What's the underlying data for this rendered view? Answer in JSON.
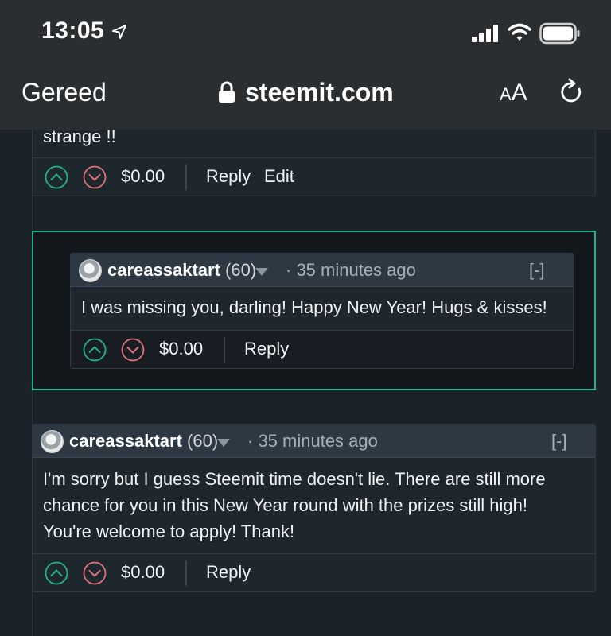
{
  "status_bar": {
    "time": "13:05"
  },
  "browser": {
    "back_label": "Gereed",
    "url": "steemit.com",
    "text_size_small": "A",
    "text_size_big": "A"
  },
  "top_comment": {
    "body_tail": "strange !!",
    "payout": "$0.00",
    "actions": [
      "Reply",
      "Edit"
    ]
  },
  "highlighted_reply": {
    "author": "careassaktart",
    "reputation": "(60)",
    "time_ago": "· 35 minutes ago",
    "collapse": "[-]",
    "body": "I was missing you, darling! Happy New Year! Hugs & kisses!",
    "payout": "$0.00",
    "reply_label": "Reply"
  },
  "second_reply": {
    "author": "careassaktart",
    "reputation": "(60)",
    "time_ago": "· 35 minutes ago",
    "collapse": "[-]",
    "body_lines": [
      "I'm sorry but I guess Steemit time doesn't lie. There are still more",
      "chance for you in this New Year round with the prizes still high!",
      "You're welcome to apply! Thank!"
    ],
    "payout": "$0.00",
    "reply_label": "Reply"
  },
  "colors": {
    "upvote": "#22b28f",
    "downvote": "#e0727a",
    "highlight_border": "#22b28f"
  }
}
